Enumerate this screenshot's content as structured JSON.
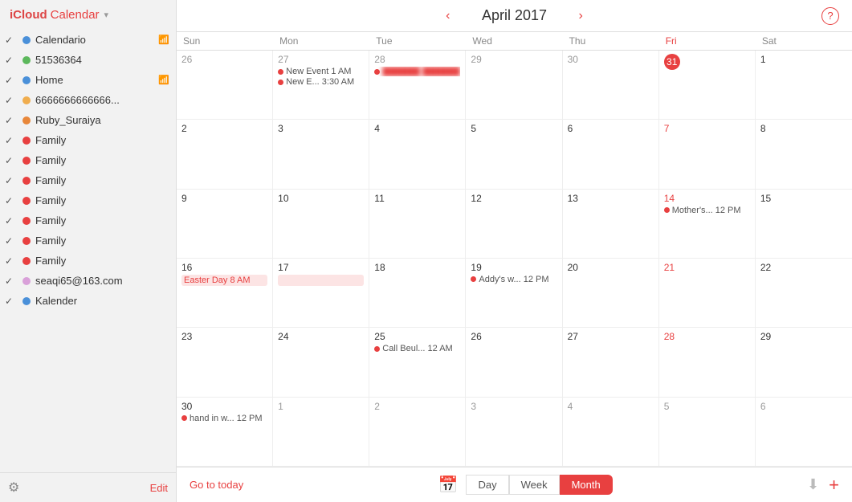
{
  "sidebar": {
    "brand_icloud": "iCloud",
    "brand_calendar": "Calendar",
    "items": [
      {
        "id": "calendario",
        "label": "Calendario",
        "dot_color": "#4a90d9",
        "checked": true,
        "wifi": true
      },
      {
        "id": "51536364",
        "label": "51536364",
        "dot_color": "#5cb85c",
        "checked": true,
        "wifi": false
      },
      {
        "id": "home",
        "label": "Home",
        "dot_color": "#4a90d9",
        "checked": true,
        "wifi": true
      },
      {
        "id": "66666",
        "label": "6666666666666...",
        "dot_color": "#f0ad4e",
        "checked": true,
        "wifi": false
      },
      {
        "id": "ruby",
        "label": "Ruby_Suraiya",
        "dot_color": "#e8873a",
        "checked": true,
        "wifi": false
      },
      {
        "id": "family1",
        "label": "Family",
        "dot_color": "#e84040",
        "checked": true,
        "wifi": false
      },
      {
        "id": "family2",
        "label": "Family",
        "dot_color": "#e84040",
        "checked": true,
        "wifi": false
      },
      {
        "id": "family3",
        "label": "Family",
        "dot_color": "#e84040",
        "checked": true,
        "wifi": false
      },
      {
        "id": "family4",
        "label": "Family",
        "dot_color": "#e84040",
        "checked": true,
        "wifi": false
      },
      {
        "id": "family5",
        "label": "Family",
        "dot_color": "#e84040",
        "checked": true,
        "wifi": false
      },
      {
        "id": "family6",
        "label": "Family",
        "dot_color": "#e84040",
        "checked": true,
        "wifi": false
      },
      {
        "id": "family7",
        "label": "Family",
        "dot_color": "#e84040",
        "checked": true,
        "wifi": false
      },
      {
        "id": "seaqi",
        "label": "seaqi65@163.com",
        "dot_color": "#d9a0d9",
        "checked": true,
        "wifi": false
      },
      {
        "id": "kalender",
        "label": "Kalender",
        "dot_color": "#4a90d9",
        "checked": true,
        "wifi": false
      }
    ],
    "edit_label": "Edit"
  },
  "header": {
    "title": "April 2017",
    "prev_label": "‹",
    "next_label": "›",
    "help_label": "?"
  },
  "day_headers": [
    "Sun",
    "Mon",
    "Tue",
    "Wed",
    "Thu",
    "Fri",
    "Sat"
  ],
  "weeks": [
    {
      "days": [
        {
          "num": "26",
          "type": "other"
        },
        {
          "num": "27",
          "type": "other",
          "events": [
            {
              "text": "New Event  1 AM",
              "dot": true
            },
            {
              "text": "New E...  3:30 AM",
              "dot": true
            }
          ]
        },
        {
          "num": "28",
          "type": "other",
          "events": [
            {
              "text": "██████  ██████",
              "dot": true,
              "blurred": true
            }
          ]
        },
        {
          "num": "29",
          "type": "other"
        },
        {
          "num": "30",
          "type": "other"
        },
        {
          "num": "31",
          "type": "today"
        },
        {
          "num": "1",
          "type": "current"
        }
      ]
    },
    {
      "days": [
        {
          "num": "2",
          "type": "current"
        },
        {
          "num": "3",
          "type": "current"
        },
        {
          "num": "4",
          "type": "current"
        },
        {
          "num": "5",
          "type": "current"
        },
        {
          "num": "6",
          "type": "current"
        },
        {
          "num": "7",
          "type": "current",
          "friday": true
        },
        {
          "num": "8",
          "type": "current"
        }
      ]
    },
    {
      "days": [
        {
          "num": "9",
          "type": "current"
        },
        {
          "num": "10",
          "type": "current"
        },
        {
          "num": "11",
          "type": "current"
        },
        {
          "num": "12",
          "type": "current"
        },
        {
          "num": "13",
          "type": "current"
        },
        {
          "num": "14",
          "type": "current",
          "friday": true,
          "events": [
            {
              "text": "Mother's...  12 PM",
              "dot": true
            }
          ]
        },
        {
          "num": "15",
          "type": "current"
        }
      ]
    },
    {
      "days": [
        {
          "num": "16",
          "type": "current",
          "events": [
            {
              "text": "Easter Day  8 AM",
              "dot": true,
              "pink_bg": true
            }
          ]
        },
        {
          "num": "17",
          "type": "current",
          "events": [
            {
              "text": "",
              "pink_bg": true,
              "spacer": true
            }
          ]
        },
        {
          "num": "18",
          "type": "current"
        },
        {
          "num": "19",
          "type": "current",
          "events": [
            {
              "text": "Addy's w...  12 PM",
              "dot": true
            }
          ]
        },
        {
          "num": "20",
          "type": "current"
        },
        {
          "num": "21",
          "type": "current",
          "friday": true
        },
        {
          "num": "22",
          "type": "current"
        }
      ]
    },
    {
      "days": [
        {
          "num": "23",
          "type": "current"
        },
        {
          "num": "24",
          "type": "current"
        },
        {
          "num": "25",
          "type": "current",
          "events": [
            {
              "text": "Call Beul...  12 AM",
              "dot": true
            }
          ]
        },
        {
          "num": "26",
          "type": "current"
        },
        {
          "num": "27",
          "type": "current"
        },
        {
          "num": "28",
          "type": "current",
          "friday": true
        },
        {
          "num": "29",
          "type": "current"
        }
      ]
    },
    {
      "days": [
        {
          "num": "30",
          "type": "current",
          "events": [
            {
              "text": "hand in w...  12 PM",
              "dot": true
            }
          ]
        },
        {
          "num": "1",
          "type": "other"
        },
        {
          "num": "2",
          "type": "other"
        },
        {
          "num": "3",
          "type": "other"
        },
        {
          "num": "4",
          "type": "other"
        },
        {
          "num": "5",
          "type": "other",
          "friday": true
        },
        {
          "num": "6",
          "type": "other"
        }
      ]
    }
  ],
  "toolbar": {
    "go_today": "Go to today",
    "day_label": "Day",
    "week_label": "Week",
    "month_label": "Month",
    "active_view": "Month"
  }
}
